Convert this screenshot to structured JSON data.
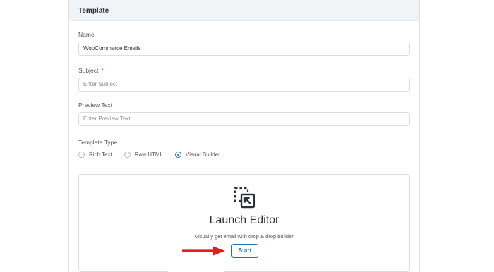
{
  "panel": {
    "title": "Template"
  },
  "form": {
    "name": {
      "label": "Name",
      "value": "WooCommerce Emails"
    },
    "subject": {
      "label": "Subject",
      "required_mark": "*",
      "placeholder": "Enter Subject"
    },
    "preview_text": {
      "label": "Preview Text",
      "placeholder": "Enter Preview Text"
    },
    "template_type": {
      "label": "Template Type",
      "options": [
        {
          "label": "Rich Text",
          "selected": false
        },
        {
          "label": "Raw HTML",
          "selected": false
        },
        {
          "label": "Visual Builder",
          "selected": true
        }
      ]
    }
  },
  "editor": {
    "icon": "drag-select-cursor-icon",
    "title": "Launch Editor",
    "description": "Visually get email with drop & drop builder",
    "start_label": "Start"
  },
  "annotation": {
    "arrow_color": "#e01e1e"
  },
  "colors": {
    "accent": "#2271b1",
    "header_bg": "#f1f4f7"
  }
}
